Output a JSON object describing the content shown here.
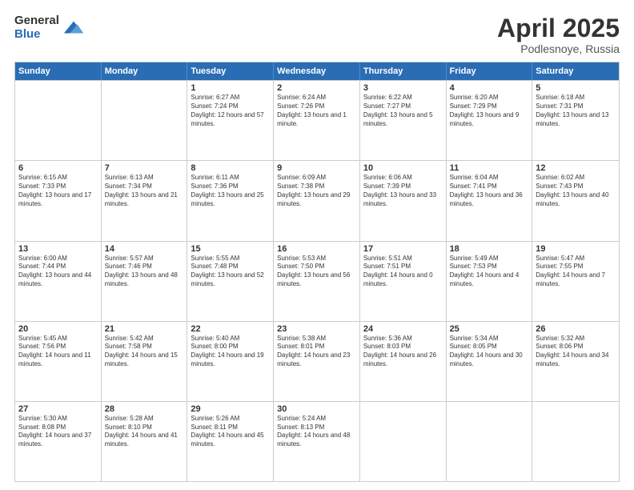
{
  "logo": {
    "general": "General",
    "blue": "Blue"
  },
  "title": "April 2025",
  "subtitle": "Podlesnoye, Russia",
  "days": [
    "Sunday",
    "Monday",
    "Tuesday",
    "Wednesday",
    "Thursday",
    "Friday",
    "Saturday"
  ],
  "weeks": [
    [
      {
        "day": "",
        "text": ""
      },
      {
        "day": "",
        "text": ""
      },
      {
        "day": "1",
        "text": "Sunrise: 6:27 AM\nSunset: 7:24 PM\nDaylight: 12 hours and 57 minutes."
      },
      {
        "day": "2",
        "text": "Sunrise: 6:24 AM\nSunset: 7:26 PM\nDaylight: 13 hours and 1 minute."
      },
      {
        "day": "3",
        "text": "Sunrise: 6:22 AM\nSunset: 7:27 PM\nDaylight: 13 hours and 5 minutes."
      },
      {
        "day": "4",
        "text": "Sunrise: 6:20 AM\nSunset: 7:29 PM\nDaylight: 13 hours and 9 minutes."
      },
      {
        "day": "5",
        "text": "Sunrise: 6:18 AM\nSunset: 7:31 PM\nDaylight: 13 hours and 13 minutes."
      }
    ],
    [
      {
        "day": "6",
        "text": "Sunrise: 6:15 AM\nSunset: 7:33 PM\nDaylight: 13 hours and 17 minutes."
      },
      {
        "day": "7",
        "text": "Sunrise: 6:13 AM\nSunset: 7:34 PM\nDaylight: 13 hours and 21 minutes."
      },
      {
        "day": "8",
        "text": "Sunrise: 6:11 AM\nSunset: 7:36 PM\nDaylight: 13 hours and 25 minutes."
      },
      {
        "day": "9",
        "text": "Sunrise: 6:09 AM\nSunset: 7:38 PM\nDaylight: 13 hours and 29 minutes."
      },
      {
        "day": "10",
        "text": "Sunrise: 6:06 AM\nSunset: 7:39 PM\nDaylight: 13 hours and 33 minutes."
      },
      {
        "day": "11",
        "text": "Sunrise: 6:04 AM\nSunset: 7:41 PM\nDaylight: 13 hours and 36 minutes."
      },
      {
        "day": "12",
        "text": "Sunrise: 6:02 AM\nSunset: 7:43 PM\nDaylight: 13 hours and 40 minutes."
      }
    ],
    [
      {
        "day": "13",
        "text": "Sunrise: 6:00 AM\nSunset: 7:44 PM\nDaylight: 13 hours and 44 minutes."
      },
      {
        "day": "14",
        "text": "Sunrise: 5:57 AM\nSunset: 7:46 PM\nDaylight: 13 hours and 48 minutes."
      },
      {
        "day": "15",
        "text": "Sunrise: 5:55 AM\nSunset: 7:48 PM\nDaylight: 13 hours and 52 minutes."
      },
      {
        "day": "16",
        "text": "Sunrise: 5:53 AM\nSunset: 7:50 PM\nDaylight: 13 hours and 56 minutes."
      },
      {
        "day": "17",
        "text": "Sunrise: 5:51 AM\nSunset: 7:51 PM\nDaylight: 14 hours and 0 minutes."
      },
      {
        "day": "18",
        "text": "Sunrise: 5:49 AM\nSunset: 7:53 PM\nDaylight: 14 hours and 4 minutes."
      },
      {
        "day": "19",
        "text": "Sunrise: 5:47 AM\nSunset: 7:55 PM\nDaylight: 14 hours and 7 minutes."
      }
    ],
    [
      {
        "day": "20",
        "text": "Sunrise: 5:45 AM\nSunset: 7:56 PM\nDaylight: 14 hours and 11 minutes."
      },
      {
        "day": "21",
        "text": "Sunrise: 5:42 AM\nSunset: 7:58 PM\nDaylight: 14 hours and 15 minutes."
      },
      {
        "day": "22",
        "text": "Sunrise: 5:40 AM\nSunset: 8:00 PM\nDaylight: 14 hours and 19 minutes."
      },
      {
        "day": "23",
        "text": "Sunrise: 5:38 AM\nSunset: 8:01 PM\nDaylight: 14 hours and 23 minutes."
      },
      {
        "day": "24",
        "text": "Sunrise: 5:36 AM\nSunset: 8:03 PM\nDaylight: 14 hours and 26 minutes."
      },
      {
        "day": "25",
        "text": "Sunrise: 5:34 AM\nSunset: 8:05 PM\nDaylight: 14 hours and 30 minutes."
      },
      {
        "day": "26",
        "text": "Sunrise: 5:32 AM\nSunset: 8:06 PM\nDaylight: 14 hours and 34 minutes."
      }
    ],
    [
      {
        "day": "27",
        "text": "Sunrise: 5:30 AM\nSunset: 8:08 PM\nDaylight: 14 hours and 37 minutes."
      },
      {
        "day": "28",
        "text": "Sunrise: 5:28 AM\nSunset: 8:10 PM\nDaylight: 14 hours and 41 minutes."
      },
      {
        "day": "29",
        "text": "Sunrise: 5:26 AM\nSunset: 8:11 PM\nDaylight: 14 hours and 45 minutes."
      },
      {
        "day": "30",
        "text": "Sunrise: 5:24 AM\nSunset: 8:13 PM\nDaylight: 14 hours and 48 minutes."
      },
      {
        "day": "",
        "text": ""
      },
      {
        "day": "",
        "text": ""
      },
      {
        "day": "",
        "text": ""
      }
    ]
  ]
}
